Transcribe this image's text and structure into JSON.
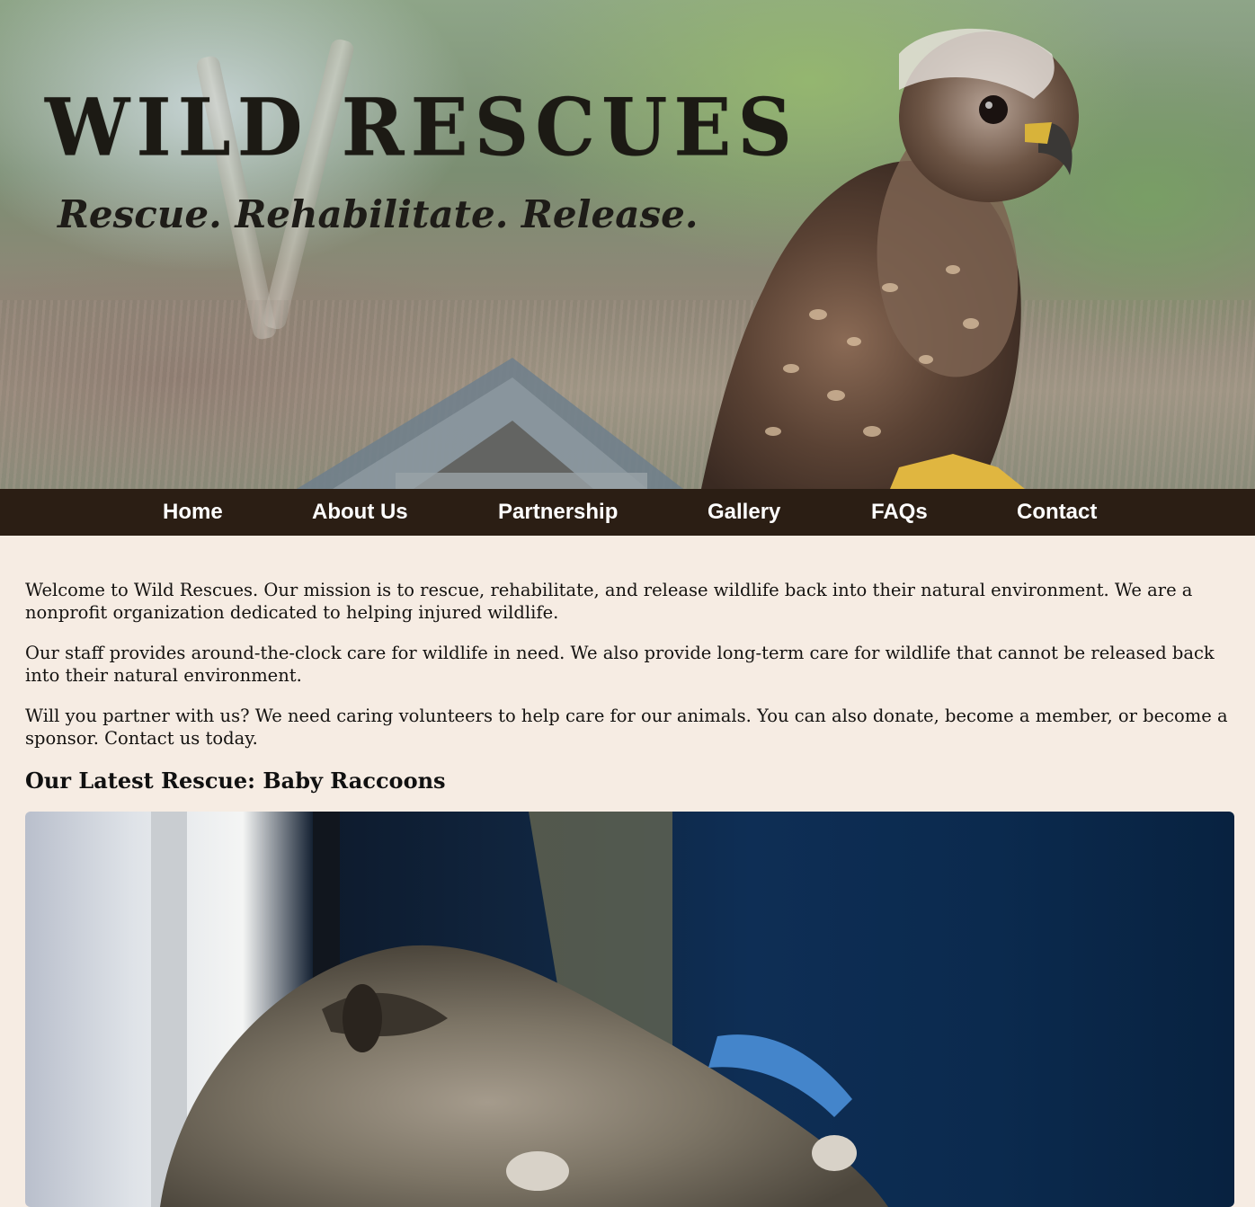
{
  "brand": {
    "title": "WILD RESCUES",
    "tagline": "Rescue. Rehabilitate. Release."
  },
  "nav": {
    "items": [
      {
        "label": "Home"
      },
      {
        "label": "About Us"
      },
      {
        "label": "Partnership"
      },
      {
        "label": "Gallery"
      },
      {
        "label": "FAQs"
      },
      {
        "label": "Contact"
      }
    ]
  },
  "main": {
    "paragraphs": [
      "Welcome to Wild Rescues. Our mission is to rescue, rehabilitate, and release wildlife back into their natural environment. We are a nonprofit organization dedicated to helping injured wildlife.",
      "Our staff provides around-the-clock care for wildlife in need. We also provide long-term care for wildlife that cannot be released back into their natural environment.",
      "Will you partner with us? We need caring volunteers to help care for our animals. You can also donate, become a member, or become a sponsor. Contact us today."
    ],
    "latest_heading": "Our Latest Rescue: Baby Raccoons"
  },
  "colors": {
    "nav_bg": "#2b1e14",
    "page_bg": "#f6ece3",
    "nav_text": "#ffffff"
  }
}
